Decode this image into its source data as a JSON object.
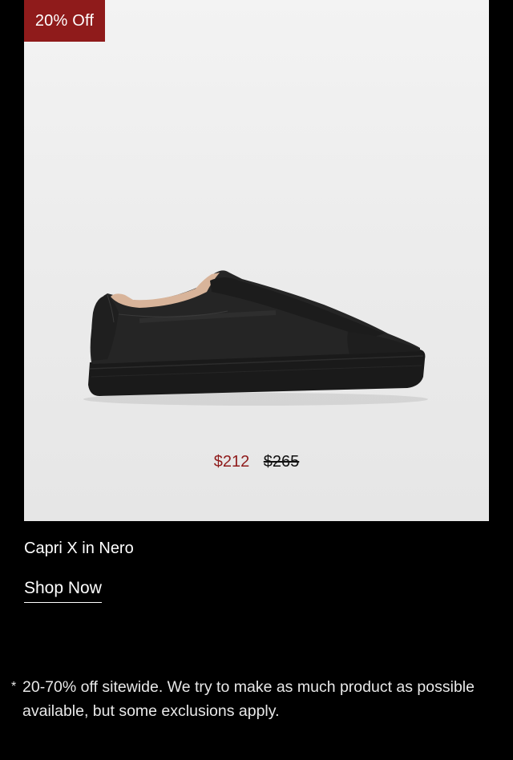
{
  "promo": {
    "badge": "20% Off",
    "price_sale": "$212",
    "price_original": "$265",
    "product_name": "Capri X in Nero",
    "cta_label": "Shop Now"
  },
  "footer": {
    "asterisk": "*",
    "disclaimer": "20-70% off sitewide. We try to make as much product as possible available, but some exclusions apply."
  },
  "colors": {
    "page_background": "#000000",
    "badge_background": "#8f1b1b",
    "sale_price": "#8f1b1b",
    "card_background": "#eeeeee"
  },
  "icons": {
    "product_image": "black-leather-sneaker-image"
  }
}
